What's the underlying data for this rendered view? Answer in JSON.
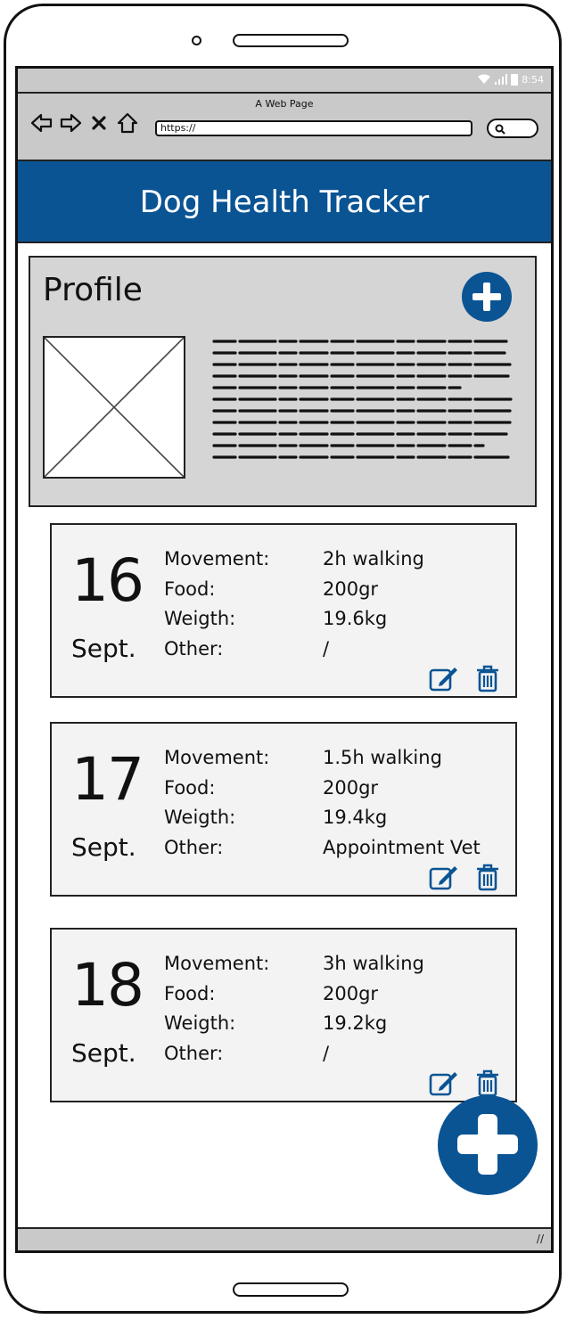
{
  "status": {
    "time": "8:54"
  },
  "browser": {
    "page_title": "A Web Page",
    "url": "https://"
  },
  "app": {
    "title": "Dog Health Tracker"
  },
  "profile": {
    "title": "Profile"
  },
  "labels": {
    "movement": "Movement:",
    "food": "Food:",
    "weight": "Weigth:",
    "other": "Other:"
  },
  "entries": [
    {
      "day": "16",
      "month": "Sept.",
      "movement": "2h walking",
      "food": "200gr",
      "weight": "19.6kg",
      "other": "/"
    },
    {
      "day": "17",
      "month": "Sept.",
      "movement": "1.5h walking",
      "food": "200gr",
      "weight": "19.4kg",
      "other": "Appointment Vet"
    },
    {
      "day": "18",
      "month": "Sept.",
      "movement": "3h walking",
      "food": "200gr",
      "weight": "19.2kg",
      "other": "/"
    }
  ],
  "icons": {
    "back": "arrow-left-icon",
    "forward": "arrow-right-icon",
    "stop": "close-icon",
    "home": "home-icon",
    "search": "search-icon",
    "edit": "edit-icon",
    "delete": "trash-icon",
    "add": "plus-icon"
  },
  "colors": {
    "primary": "#0a5494",
    "chrome": "#c9c9c9",
    "card": "#f3f3f3",
    "profile_bg": "#d5d5d5"
  }
}
